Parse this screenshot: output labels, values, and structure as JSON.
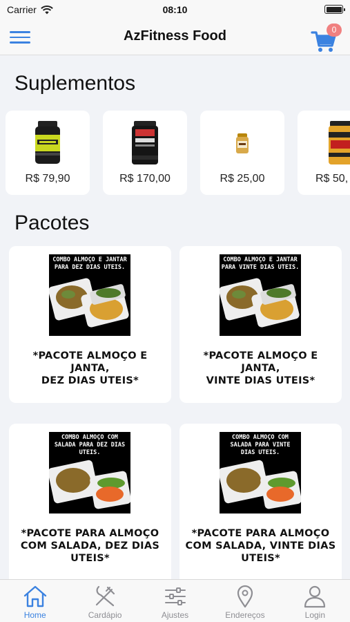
{
  "status": {
    "carrier": "Carrier",
    "time": "08:10"
  },
  "header": {
    "title": "AzFitness Food",
    "cart_count": "0"
  },
  "sections": {
    "supplements": "Suplementos",
    "packages": "Pacotes"
  },
  "supplements": [
    {
      "price": "R$ 79,90",
      "icon": "creatine-jar-icon"
    },
    {
      "price": "R$ 170,00",
      "icon": "whey-protein-jar-icon"
    },
    {
      "price": "R$ 25,00",
      "icon": "small-supplement-jar-icon"
    },
    {
      "price": "R$ 50,",
      "icon": "rush-preworkout-jar-icon"
    }
  ],
  "packages": [
    {
      "banner": [
        "COMBO ALMOÇO E JANTAR",
        "PARA DEZ DIAS UTEIS."
      ],
      "caption": [
        "*PACOTE ALMOÇO E JANTA,",
        "DEZ DIAS UTEIS*"
      ]
    },
    {
      "banner": [
        "COMBO ALMOÇO E JANTAR",
        "PARA VINTE DIAS UTEIS."
      ],
      "caption": [
        "*PACOTE ALMOÇO E JANTA,",
        "VINTE DIAS UTEIS*"
      ]
    },
    {
      "banner": [
        "COMBO ALMOÇO COM",
        "SALADA PARA DEZ DIAS",
        "UTEIS."
      ],
      "caption": [
        "*PACOTE PARA ALMOÇO",
        "COM SALADA, DEZ DIAS",
        "UTEIS*"
      ]
    },
    {
      "banner": [
        "COMBO ALMOÇO COM",
        "SALADA PARA VINTE",
        "DIAS UTEIS."
      ],
      "caption": [
        "*PACOTE PARA ALMOÇO",
        "COM SALADA, VINTE DIAS",
        "UTEIS*"
      ]
    }
  ],
  "tabs": [
    {
      "label": "Home",
      "icon": "home-icon",
      "active": true
    },
    {
      "label": "Cardápio",
      "icon": "utensils-icon",
      "active": false
    },
    {
      "label": "Ajustes",
      "icon": "sliders-icon",
      "active": false
    },
    {
      "label": "Endereços",
      "icon": "map-pin-icon",
      "active": false
    },
    {
      "label": "Login",
      "icon": "user-icon",
      "active": false
    }
  ],
  "colors": {
    "accent": "#3b82e0",
    "badge": "#f08080",
    "background": "#f1f3f7",
    "inactive": "#8e8e93"
  }
}
